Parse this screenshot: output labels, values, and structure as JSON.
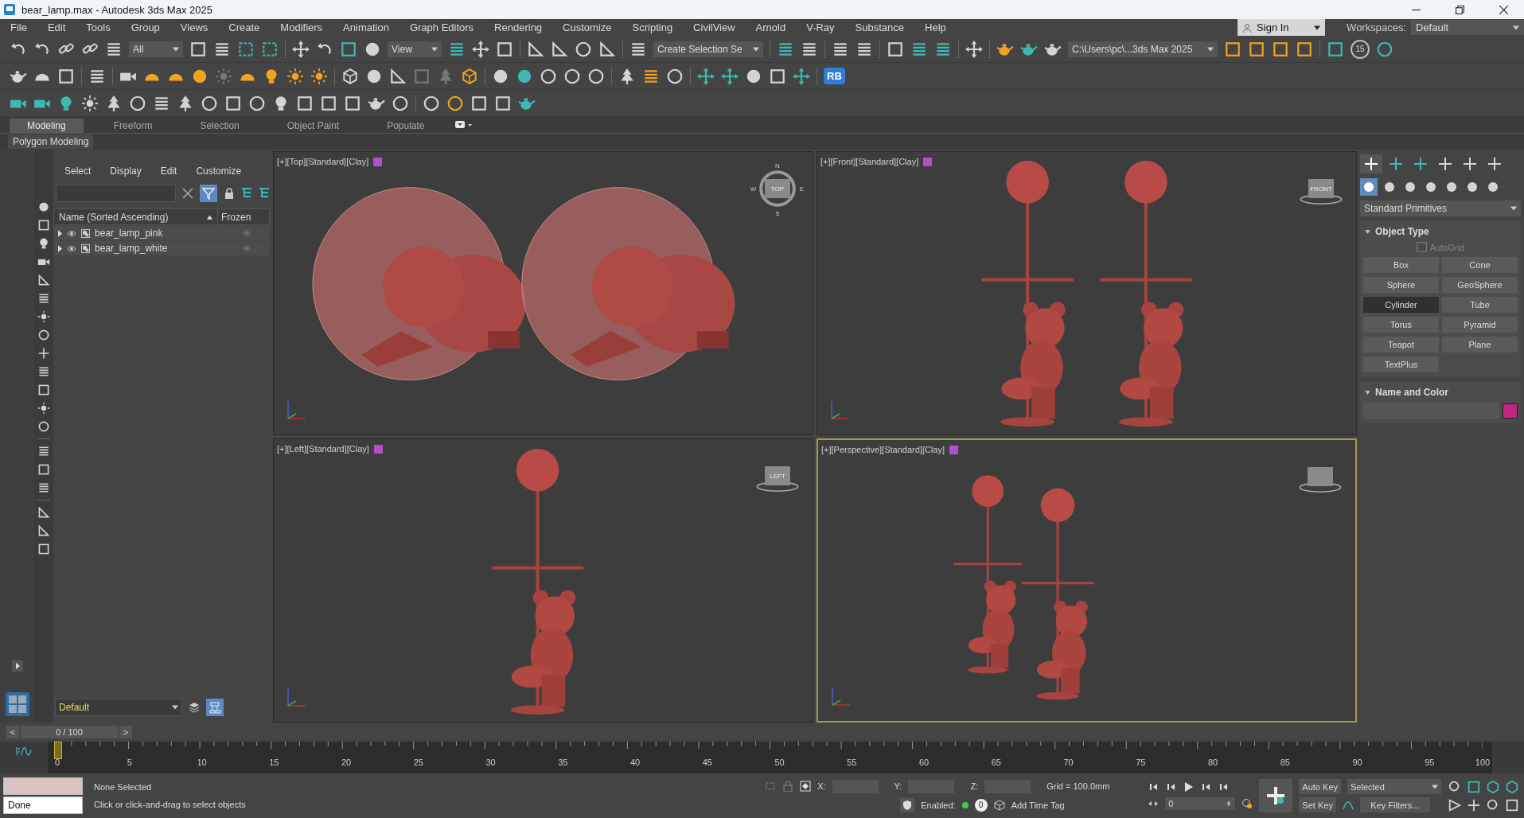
{
  "window": {
    "title": "bear_lamp.max - Autodesk 3ds Max 2025"
  },
  "menu": [
    "File",
    "Edit",
    "Tools",
    "Group",
    "Views",
    "Create",
    "Modifiers",
    "Animation",
    "Graph Editors",
    "Rendering",
    "Customize",
    "Scripting",
    "CivilView",
    "Arnold",
    "V-Ray",
    "Substance",
    "Help"
  ],
  "sign_in": {
    "label": "Sign In"
  },
  "workspaces": {
    "label": "Workspaces:",
    "value": "Default"
  },
  "toolbar": {
    "selection_filter": "All",
    "reference_coord": "View",
    "named_selection": "Create Selection Se",
    "project_path": "C:\\Users\\pc\\...3ds Max 2025",
    "autosave_count": "15",
    "badge": "RB"
  },
  "ribbon_tabs": [
    {
      "label": "Modeling",
      "selected": true
    },
    {
      "label": "Freeform",
      "selected": false
    },
    {
      "label": "Selection",
      "selected": false
    },
    {
      "label": "Object Paint",
      "selected": false
    },
    {
      "label": "Populate",
      "selected": false
    }
  ],
  "ribbon_panel": "Polygon Modeling",
  "scene_explorer": {
    "menu": [
      "Select",
      "Display",
      "Edit",
      "Customize"
    ],
    "columns": [
      "Name (Sorted Ascending)",
      "Frozen"
    ],
    "rows": [
      {
        "name": "bear_lamp_pink"
      },
      {
        "name": "bear_lamp_white"
      }
    ],
    "layer": "Default"
  },
  "viewports": [
    {
      "label": "[+][Top][Standard][Clay]",
      "kind": "top",
      "selected": false,
      "viewcube": {
        "face": "TOP",
        "compass": [
          "N",
          "W",
          "E",
          "S"
        ]
      }
    },
    {
      "label": "[+][Front][Standard][Clay]",
      "kind": "front",
      "selected": false,
      "viewcube": {
        "face": "FRONT"
      }
    },
    {
      "label": "[+][Left][Standard][Clay]",
      "kind": "left",
      "selected": false,
      "viewcube": {
        "face": "LEFT"
      }
    },
    {
      "label": "[+][Perspective][Standard][Clay]",
      "kind": "perspective",
      "selected": true
    }
  ],
  "command_panel": {
    "tabs": [
      {
        "selected": true
      },
      {
        "selected": false
      },
      {
        "selected": false
      },
      {
        "selected": false
      },
      {
        "selected": false
      },
      {
        "selected": false
      }
    ],
    "categories": [
      {
        "selected": true
      },
      {
        "selected": false
      },
      {
        "selected": false
      },
      {
        "selected": false
      },
      {
        "selected": false
      },
      {
        "selected": false
      },
      {
        "selected": false
      }
    ],
    "dropdown": "Standard Primitives",
    "object_type": {
      "title": "Object Type",
      "autogrid": {
        "label": "AutoGrid",
        "checked": false,
        "disabled": true
      },
      "buttons": [
        {
          "label": "Box",
          "selected": false
        },
        {
          "label": "Cone",
          "selected": false
        },
        {
          "label": "Sphere",
          "selected": false
        },
        {
          "label": "GeoSphere",
          "selected": false
        },
        {
          "label": "Cylinder",
          "selected": true
        },
        {
          "label": "Tube",
          "selected": false
        },
        {
          "label": "Torus",
          "selected": false
        },
        {
          "label": "Pyramid",
          "selected": false
        },
        {
          "label": "Teapot",
          "selected": false
        },
        {
          "label": "Plane",
          "selected": false
        },
        {
          "label": "TextPlus",
          "selected": false
        }
      ]
    },
    "name_color": {
      "title": "Name and Color",
      "color": "#c4267f"
    }
  },
  "timeline": {
    "frame": "0 / 100",
    "level": 0,
    "prev": "<",
    "next": ">",
    "ticks": [
      "0",
      "5",
      "10",
      "15",
      "20",
      "25",
      "30",
      "35",
      "40",
      "45",
      "50",
      "55",
      "60",
      "65",
      "70",
      "75",
      "80",
      "85",
      "90",
      "95",
      "100"
    ]
  },
  "status": {
    "done": "Done",
    "selection": "None Selected",
    "prompt": "Click or click-and-drag to select objects",
    "x_label": "X:",
    "y_label": "Y:",
    "z_label": "Z:",
    "grid": "Grid = 100.0mm",
    "enabled": "Enabled:",
    "enabled_count": "0",
    "add_time_tag": "Add Time Tag",
    "auto_key": "Auto Key",
    "set_key": "Set Key",
    "key_mode": "Selected",
    "frame": "0",
    "key_filters": "Key Filters..."
  }
}
